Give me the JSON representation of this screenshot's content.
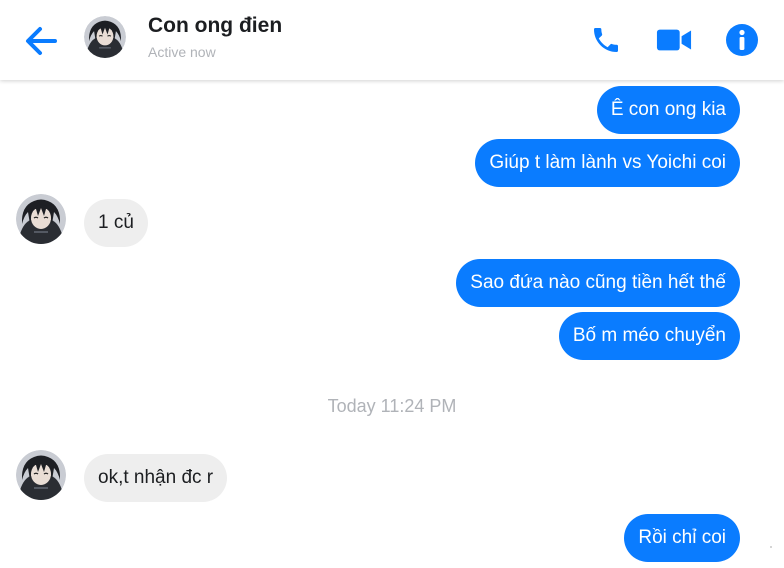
{
  "colors": {
    "accent": "#0a7cff",
    "outgoing_bubble": "#0a7cff",
    "incoming_bubble": "#eeeeee",
    "muted_text": "#b0b3b8"
  },
  "header": {
    "back_icon": "arrow-left-icon",
    "contact_name": "Con ong đien",
    "status": "Active now",
    "actions": [
      {
        "icon": "phone-icon"
      },
      {
        "icon": "video-camera-icon"
      },
      {
        "icon": "info-icon"
      }
    ]
  },
  "conversation": {
    "messages": [
      {
        "direction": "outgoing",
        "text": "Ê con ong kia"
      },
      {
        "direction": "outgoing",
        "text": "Giúp t làm lành vs Yoichi coi"
      },
      {
        "direction": "incoming",
        "text": "1 củ"
      },
      {
        "direction": "outgoing",
        "text": "Sao đứa nào cũng tiền hết thế"
      },
      {
        "direction": "outgoing",
        "text": "Bố m méo chuyển"
      },
      {
        "direction": "incoming",
        "text": "ok,t nhận đc r"
      },
      {
        "direction": "outgoing",
        "text": "Rồi chỉ coi"
      }
    ],
    "timestamp": "Today 11:24 PM"
  }
}
